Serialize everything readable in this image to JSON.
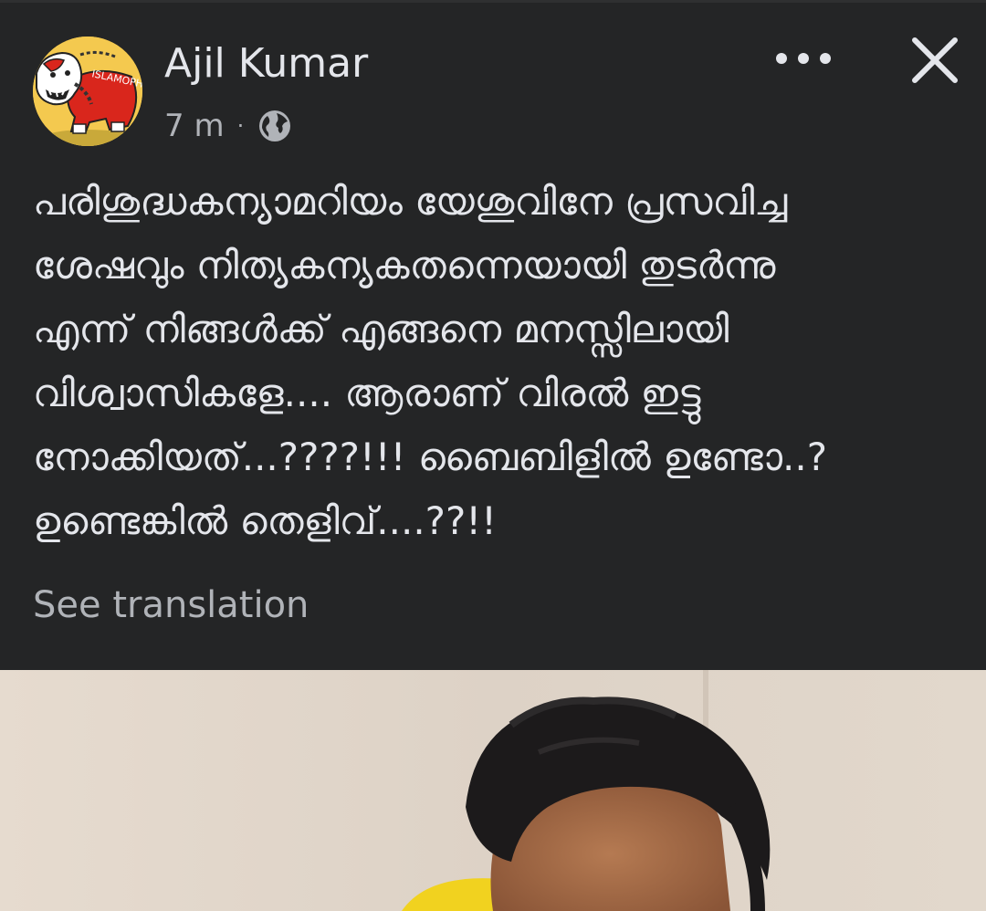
{
  "post": {
    "author": "Ajil Kumar",
    "time": "7 m",
    "separator": "·",
    "privacy_icon": "globe-icon",
    "avatar_text": "ISLAMOPHO",
    "body_lines": [
      "പരിശുദ്ധകന്യാമറിയം യേശുവിനേ പ്രസവിച്ച",
      "ശേഷവും നിത്യകന്യകതന്നെയായി തുടർന്നു",
      "എന്ന് നിങ്ങൾക്ക് എങ്ങനെ മനസ്സിലായി",
      "വിശ്വാസികളേ.... ആരാണ് വിരൽ ഇട്ടു",
      "നോക്കിയത്...????!!! ബൈബിളിൽ ഉണ്ടോ..?",
      "ഉണ്ടെങ്കിൽ തെളിവ്....??!!"
    ],
    "see_translation": "See translation"
  },
  "colors": {
    "background": "#242526",
    "primary_text": "#e4e6eb",
    "secondary_text": "#b0b3b8"
  }
}
